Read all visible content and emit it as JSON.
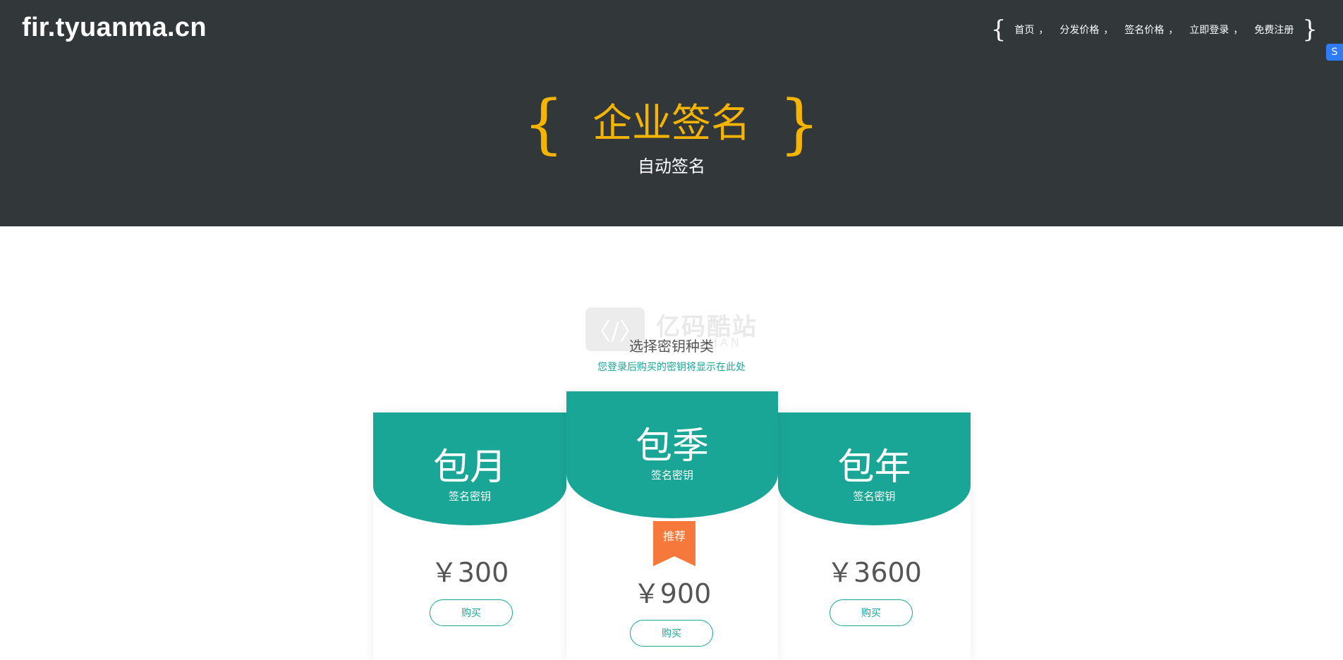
{
  "header": {
    "logo": "fir.tyuanma.cn",
    "nav": [
      {
        "label": "首页"
      },
      {
        "label": "分发价格"
      },
      {
        "label": "签名价格"
      },
      {
        "label": "立即登录"
      },
      {
        "label": "免费注册"
      }
    ],
    "open_brace": "{",
    "close_brace": "}",
    "separator": "，"
  },
  "side_widget": {
    "icon": "S"
  },
  "hero": {
    "open_brace": "{",
    "close_brace": "}",
    "title": "企业签名",
    "subtitle": "自动签名"
  },
  "watermark": {
    "icon": "〈/〉",
    "text": "亿码酷站",
    "sub": "HAN"
  },
  "section": {
    "title": "选择密钥种类",
    "subtitle": "您登录后购买的密钥将显示在此处"
  },
  "plans": [
    {
      "name": "包月",
      "desc": "签名密钥",
      "price": "￥300",
      "button": "购买"
    },
    {
      "name": "包季",
      "desc": "签名密钥",
      "price": "￥900",
      "button": "购买",
      "badge": "推荐"
    },
    {
      "name": "包年",
      "desc": "签名密钥",
      "price": "￥3600",
      "button": "购买"
    }
  ],
  "colors": {
    "header_bg": "#32373a",
    "accent_yellow": "#f5b400",
    "teal": "#1aa697",
    "badge_orange": "#f6793b"
  }
}
